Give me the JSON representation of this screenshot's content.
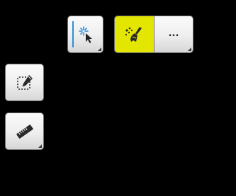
{
  "toolbar": {
    "select_tool": {
      "icon": "sparkle-cursor-icon",
      "active": false
    },
    "brush_tool": {
      "icon": "magic-broom-icon",
      "active": true
    },
    "more_button": {
      "icon": "more-icon",
      "label": "..."
    },
    "edit_tool": {
      "icon": "pencil-selection-icon"
    },
    "measure_tool": {
      "icon": "ruler-pencil-icon"
    }
  },
  "colors": {
    "background": "#000000",
    "active": "#e2e600",
    "accent": "#2d8fd6",
    "icon": "#2a2a2a"
  }
}
